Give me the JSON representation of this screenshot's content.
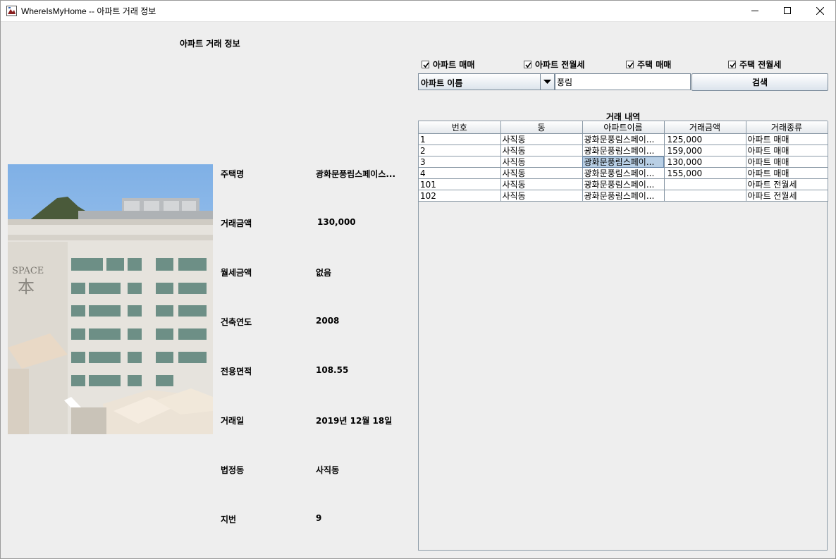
{
  "window": {
    "title": "WhereIsMyHome -- 아파트 거래 정보"
  },
  "heading": "아파트 거래 정보",
  "filters": [
    {
      "label": "아파트 매매",
      "checked": true
    },
    {
      "label": "아파트 전월세",
      "checked": true
    },
    {
      "label": "주택 매매",
      "checked": true
    },
    {
      "label": "주택 전월세",
      "checked": true
    }
  ],
  "search": {
    "field_selected": "아파트 이름",
    "query": "풍림",
    "button_label": "검색"
  },
  "details": [
    {
      "label": "주택명",
      "value": "광화문풍림스페이스..."
    },
    {
      "label": "거래금액",
      "value": "130,000"
    },
    {
      "label": "월세금액",
      "value": "없음"
    },
    {
      "label": "건축연도",
      "value": "2008"
    },
    {
      "label": "전용면적",
      "value": "108.55"
    },
    {
      "label": "거래일",
      "value": "2019년 12월 18일"
    },
    {
      "label": "법정동",
      "value": "사직동"
    },
    {
      "label": "지번",
      "value": "9"
    }
  ],
  "photo": {
    "sign_text": "SPACE",
    "sign_glyph": "本"
  },
  "table": {
    "title": "거래 내역",
    "columns": [
      "번호",
      "동",
      "아파트이름",
      "거래금액",
      "거래종류"
    ],
    "rows": [
      [
        "1",
        "사직동",
        "광화문풍림스페이...",
        "125,000",
        "아파트 매매"
      ],
      [
        "2",
        "사직동",
        "광화문풍림스페이...",
        "159,000",
        "아파트 매매"
      ],
      [
        "3",
        "사직동",
        "광화문풍림스페이...",
        "130,000",
        "아파트 매매"
      ],
      [
        "4",
        "사직동",
        "광화문풍림스페이...",
        "155,000",
        "아파트 매매"
      ],
      [
        "101",
        "사직동",
        "광화문풍림스페이...",
        "",
        "아파트 전월세"
      ],
      [
        "102",
        "사직동",
        "광화문풍림스페이...",
        "",
        "아파트 전월세"
      ]
    ],
    "selected_row": 2,
    "selected_col": 2
  }
}
